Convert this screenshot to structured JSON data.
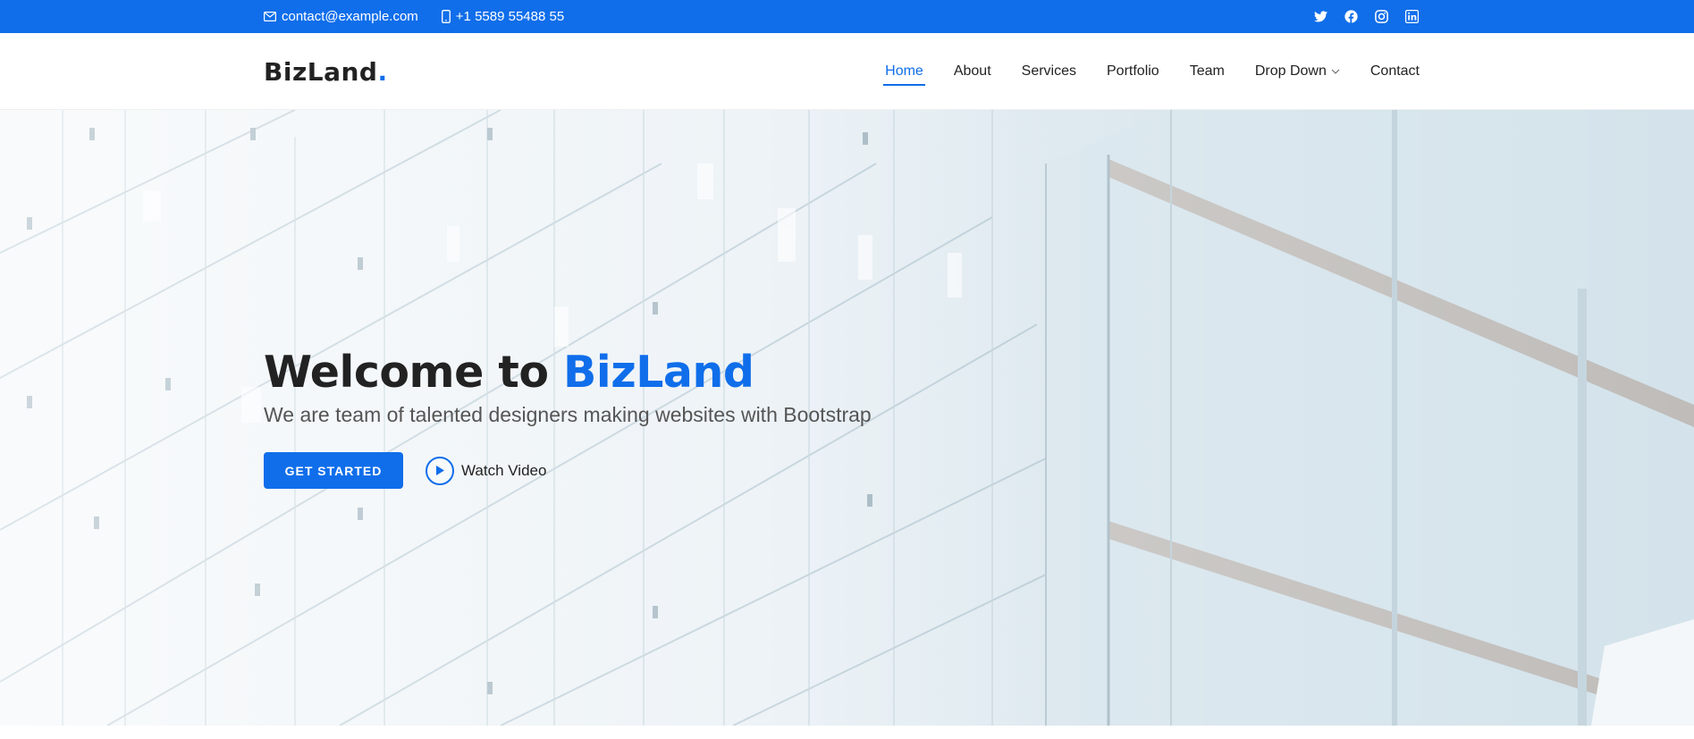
{
  "topbar": {
    "email": "contact@example.com",
    "phone": "+1 5589 55488 55",
    "social_icons": [
      "twitter-icon",
      "facebook-icon",
      "instagram-icon",
      "linkedin-icon"
    ]
  },
  "header": {
    "logo_text": "BizLand",
    "logo_dot": ".",
    "nav": [
      {
        "label": "Home",
        "active": true
      },
      {
        "label": "About"
      },
      {
        "label": "Services"
      },
      {
        "label": "Portfolio"
      },
      {
        "label": "Team"
      },
      {
        "label": "Drop Down",
        "has_dropdown": true
      },
      {
        "label": "Contact"
      }
    ]
  },
  "hero": {
    "title_prefix": "Welcome to ",
    "title_brand": "BizLand",
    "subtitle": "We are team of talented designers making websites with Bootstrap",
    "primary_button": "GET STARTED",
    "video_link": "Watch Video"
  },
  "colors": {
    "accent": "#106eea",
    "text": "#222222",
    "subtitle": "#555555"
  }
}
